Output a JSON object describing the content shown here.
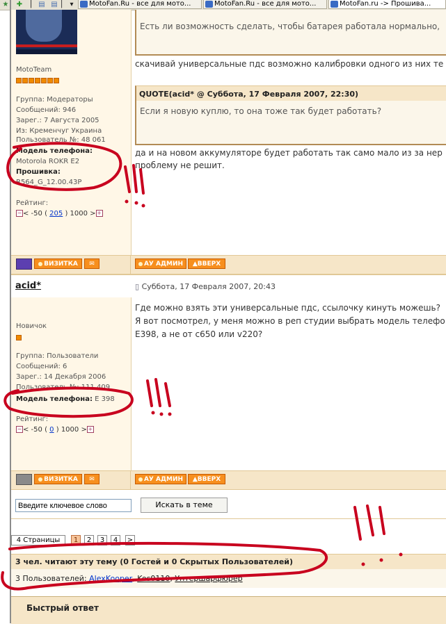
{
  "tabs": [
    {
      "title": "MotoFan.Ru - все для мото..."
    },
    {
      "title": "MotoFan.Ru - все для мото..."
    },
    {
      "title": "MotoFan.ru -> Прошива..."
    }
  ],
  "colors": {
    "accent": "#f78f1e",
    "link": "#0033cc",
    "annotation": "#c8001e"
  },
  "posts": [
    {
      "rank": "MotoTeam",
      "group": "Группа: Модераторы",
      "messages": "Сообщений: 946",
      "registered": "Зарег.: 7 Августа 2005",
      "location": "Из: Кременчуг Украина",
      "user_no": "Пользователь №: 48 061",
      "phone_label": "Модель телефона:",
      "phone_value": "Motorola ROKR E2",
      "firmware_label": "Прошивка:",
      "firmware_value": "R564_G_12.00.43P",
      "rating_label": "Рейтинг:",
      "rating_left": "< -50 (",
      "rating_value": "205",
      "rating_right": ") 1000 >",
      "quote_prev_text": "Есть ли возможность сделать, чтобы батарея работала нормально,",
      "text1": "скачивай универсальные пдс возможно калибровки одного из них те",
      "quote_header": "QUOTE(acid* @ Суббота, 17 Февраля 2007, 22:30)",
      "quote_text": "Если я новую куплю, то она тоже так будет работать?",
      "text2_line1": "да и на новом аккумуляторе будет работать так само мало из за нер",
      "text2_line2": "проблему не решит."
    },
    {
      "author": "acid*",
      "date": "Суббота, 17 Февраля 2007, 20:43",
      "rank": "Новичок",
      "group": "Группа: Пользователи",
      "messages": "Сообщений: 6",
      "registered": "Зарег.: 14 Декабря 2006",
      "user_no": "Пользователь №: 111 409",
      "phone_label": "Модель телефона:",
      "phone_value": "E 398",
      "rating_label": "Рейтинг:",
      "rating_left": "< -50 (",
      "rating_value": "0",
      "rating_right": ") 1000 >",
      "text_line1": "Где можно взять эти универсальные пдс, ссылочку кинуть можешь?",
      "text_line2": "Я вот посмотрел, у меня можно в реп студии выбрать модель телефо",
      "text_line3": "E398, а не от c650 или v220?"
    }
  ],
  "buttons": {
    "card": "ВИЗИТКА",
    "admin": "АУ АДМИН",
    "up": "ВВЕРХ"
  },
  "search": {
    "placeholder": "Введите ключевое слово",
    "button": "Искать в теме"
  },
  "pagination": {
    "label": "4 Страницы",
    "pages": [
      "1",
      "2",
      "3",
      "4"
    ],
    "current": "1",
    "next": ">"
  },
  "readers": {
    "header": "3 чел. читают эту тему (0 Гостей и 0 Скрытых Пользователей)",
    "prefix": "3 Пользователей:",
    "users": [
      "AlexKooper",
      "Kos0110",
      "Унтершарфюрер"
    ]
  },
  "quick_reply": "Быстрый ответ"
}
